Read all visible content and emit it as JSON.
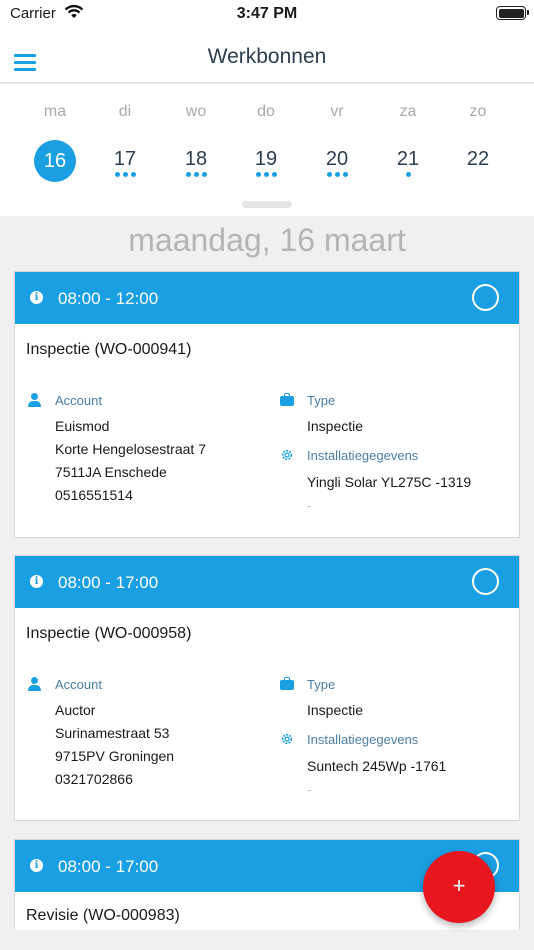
{
  "status_bar": {
    "carrier": "Carrier",
    "time": "3:47 PM"
  },
  "nav": {
    "title": "Werkbonnen"
  },
  "week": {
    "days": [
      {
        "name": "ma",
        "num": "16",
        "dots": 0,
        "selected": true
      },
      {
        "name": "di",
        "num": "17",
        "dots": 3
      },
      {
        "name": "wo",
        "num": "18",
        "dots": 3
      },
      {
        "name": "do",
        "num": "19",
        "dots": 3
      },
      {
        "name": "vr",
        "num": "20",
        "dots": 3
      },
      {
        "name": "za",
        "num": "21",
        "dots": 1
      },
      {
        "name": "zo",
        "num": "22",
        "dots": 0
      }
    ]
  },
  "date_header": "maandag, 16 maart",
  "labels": {
    "account": "Account",
    "type": "Type",
    "installation": "Installatiegegevens"
  },
  "orders": [
    {
      "time": "08:00 - 12:00",
      "title": "Inspectie (WO-000941)",
      "account_name": "Euismod",
      "street": "Korte Hengelosestraat 7",
      "city": "7511JA Enschede",
      "phone": "0516551514",
      "type": "Inspectie",
      "installation": "Yingli Solar YL275C -1319",
      "extra": "-"
    },
    {
      "time": "08:00 - 17:00",
      "title": "Inspectie (WO-000958)",
      "account_name": "Auctor",
      "street": "Surinamestraat 53",
      "city": "9715PV Groningen",
      "phone": "0321702866",
      "type": "Inspectie",
      "installation": "Suntech 245Wp -1761",
      "extra": "-"
    },
    {
      "time": "08:00 - 17:00",
      "title": "Revisie (WO-000983)"
    }
  ],
  "fab": {
    "label": "+"
  },
  "colors": {
    "accent": "#1a9fe3",
    "fab": "#e8161f"
  }
}
